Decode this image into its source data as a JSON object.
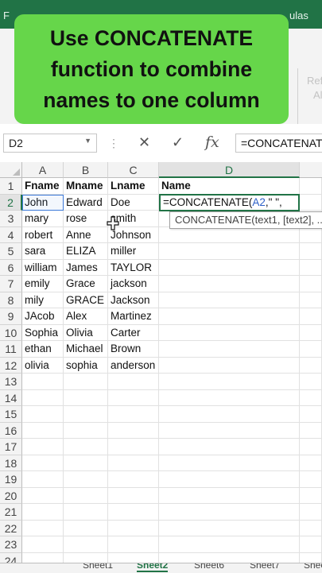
{
  "ribbon": {
    "tabs": [
      "F",
      "ulas"
    ],
    "faded_labels": [
      "Refr",
      "All"
    ],
    "colors": {
      "brand": "#217346",
      "overlay": "#66d64a",
      "accent_ref": "#2b5fc7"
    }
  },
  "overlay": {
    "text": "Use CONCATENATE\nfunction to combine\nnames to one  column"
  },
  "formula_bar": {
    "name_box": "D2",
    "cancel_icon": "close-icon",
    "enter_icon": "check-icon",
    "fx_label": "fx",
    "formula": "=CONCATENATE"
  },
  "grid": {
    "columns": [
      "A",
      "B",
      "C",
      "D"
    ],
    "rows": [
      "1",
      "2",
      "3",
      "4",
      "5",
      "6",
      "7",
      "8",
      "9",
      "10",
      "11",
      "12",
      "13",
      "14",
      "15",
      "16",
      "17",
      "18",
      "19",
      "20",
      "21",
      "22",
      "23",
      "24"
    ],
    "cells": [
      [
        "Fname",
        "Mname",
        "Lname",
        "Name"
      ],
      [
        "John",
        "Edward",
        "Doe",
        ""
      ],
      [
        "mary",
        "rose",
        "smith",
        ""
      ],
      [
        "robert",
        "Anne",
        "Johnson",
        ""
      ],
      [
        "sara",
        "ELIZA",
        "miller",
        ""
      ],
      [
        "william",
        "James",
        "TAYLOR",
        ""
      ],
      [
        "emily",
        "Grace",
        "jackson",
        ""
      ],
      [
        "mily",
        "GRACE",
        "Jackson",
        ""
      ],
      [
        "JAcob",
        "Alex",
        "Martinez",
        ""
      ],
      [
        "Sophia",
        "Olivia",
        "Carter",
        ""
      ],
      [
        "ethan",
        "Michael",
        "Brown",
        ""
      ],
      [
        "olivia",
        "sophia",
        "anderson",
        ""
      ]
    ],
    "active_cell": {
      "prefix": "=CONCATENATE(",
      "ref": "A2",
      "suffix": ",\" \","
    },
    "tooltip": "CONCATENATE(text1, [text2], ..."
  },
  "sheets": {
    "tabs": [
      "Sheet1",
      "Sheet2",
      "Sheet6",
      "Sheet7",
      "Sheet"
    ],
    "selected": "Sheet2"
  }
}
